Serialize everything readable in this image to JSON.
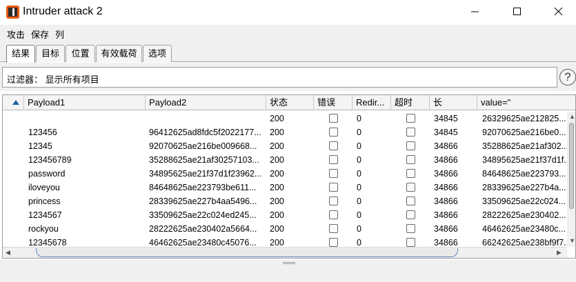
{
  "window": {
    "title": "Intruder attack 2",
    "accent": "#e8590c"
  },
  "menu": {
    "items": [
      "攻击",
      "保存",
      "列"
    ]
  },
  "tabs": [
    {
      "label": "结果",
      "active": true
    },
    {
      "label": "目标",
      "active": false
    },
    {
      "label": "位置",
      "active": false
    },
    {
      "label": "有效载荷",
      "active": false
    },
    {
      "label": "选项",
      "active": false
    }
  ],
  "filter": {
    "label": "过滤器：  显示所有项目",
    "help": "?"
  },
  "table": {
    "columns": [
      "Payload1",
      "Payload2",
      "状态",
      "错误",
      "Redir...",
      "超时",
      "长",
      "value=\""
    ],
    "rows": [
      {
        "p1": "",
        "p2": "",
        "status": "200",
        "redir": "0",
        "length": "34845",
        "value": "26329625ae212825..."
      },
      {
        "p1": "123456",
        "p2": "96412625ad8fdc5f2022177...",
        "status": "200",
        "redir": "0",
        "length": "34845",
        "value": "92070625ae216be0..."
      },
      {
        "p1": "12345",
        "p2": "92070625ae216be009668...",
        "status": "200",
        "redir": "0",
        "length": "34866",
        "value": "35288625ae21af302..."
      },
      {
        "p1": "123456789",
        "p2": "35288625ae21af30257103...",
        "status": "200",
        "redir": "0",
        "length": "34866",
        "value": "34895625ae21f37d1f..."
      },
      {
        "p1": "password",
        "p2": "34895625ae21f37d1f23962...",
        "status": "200",
        "redir": "0",
        "length": "34866",
        "value": "84648625ae223793..."
      },
      {
        "p1": "iloveyou",
        "p2": "84648625ae223793be611...",
        "status": "200",
        "redir": "0",
        "length": "34866",
        "value": "28339625ae227b4a..."
      },
      {
        "p1": "princess",
        "p2": "28339625ae227b4aa5496...",
        "status": "200",
        "redir": "0",
        "length": "34866",
        "value": "33509625ae22c024..."
      },
      {
        "p1": "1234567",
        "p2": "33509625ae22c024ed245...",
        "status": "200",
        "redir": "0",
        "length": "34866",
        "value": "28222625ae230402..."
      },
      {
        "p1": "rockyou",
        "p2": "28222625ae230402a5664...",
        "status": "200",
        "redir": "0",
        "length": "34866",
        "value": "46462625ae23480c..."
      },
      {
        "p1": "12345678",
        "p2": "46462625ae23480c45076...",
        "status": "200",
        "redir": "0",
        "length": "34866",
        "value": "66242625ae238bf9f7..."
      }
    ]
  }
}
